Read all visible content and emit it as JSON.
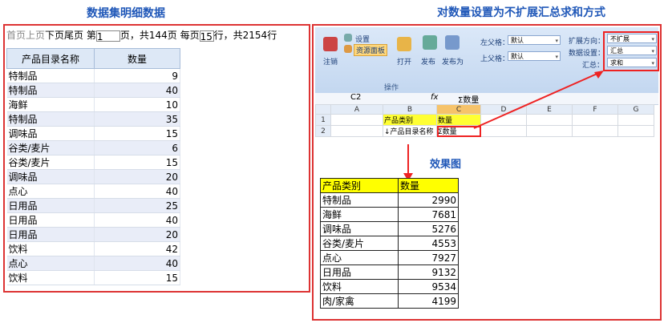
{
  "left_title": "数据集明细数据",
  "right_title": "对数量设置为不扩展汇总求和方式",
  "pager": {
    "first": "首页",
    "prev": "上页",
    "next": "下页",
    "last": "尾页",
    "page_prefix": "第",
    "page_value": "1",
    "page_suffix": "页，共144页",
    "per_page_prefix": "每页",
    "per_page_value": "15",
    "per_page_suffix": "行，共2154行"
  },
  "detail_table": {
    "headers": [
      "产品目录名称",
      "数量"
    ],
    "rows": [
      [
        "特制品",
        "9"
      ],
      [
        "特制品",
        "40"
      ],
      [
        "海鲜",
        "10"
      ],
      [
        "特制品",
        "35"
      ],
      [
        "调味品",
        "15"
      ],
      [
        "谷类/麦片",
        "6"
      ],
      [
        "谷类/麦片",
        "15"
      ],
      [
        "调味品",
        "20"
      ],
      [
        "点心",
        "40"
      ],
      [
        "日用品",
        "25"
      ],
      [
        "日用品",
        "40"
      ],
      [
        "日用品",
        "20"
      ],
      [
        "饮料",
        "42"
      ],
      [
        "点心",
        "40"
      ],
      [
        "饮料",
        "15"
      ]
    ]
  },
  "ribbon": {
    "settings": "设置",
    "resource_panel": "资源面板",
    "logout": "注销",
    "open": "打开",
    "publish": "发布",
    "publish_as": "发布为",
    "group_label": "操作",
    "left_parent_label": "左父格：",
    "left_parent_value": "默认",
    "top_parent_label": "上父格：",
    "top_parent_value": "默认",
    "expand_dir_label": "扩展方向：",
    "expand_dir_value": "不扩展",
    "data_setting_label": "数据设置：",
    "data_setting_value": "汇总",
    "summary_label": "汇总：",
    "summary_value": "求和"
  },
  "formula_bar": {
    "cell_ref": "C2",
    "fx": "fx",
    "formula": "Σ数量"
  },
  "sheet": {
    "columns": [
      "A",
      "B",
      "C",
      "D",
      "E",
      "F",
      "G"
    ],
    "rows": [
      {
        "num": "1",
        "b": "产品类别",
        "c": "数量"
      },
      {
        "num": "2",
        "b": "↓产品目录名称",
        "c": "Σ数量"
      }
    ]
  },
  "result_caption": "效果图",
  "result_table": {
    "headers": [
      "产品类别",
      "数量"
    ],
    "rows": [
      [
        "特制品",
        "2990"
      ],
      [
        "海鲜",
        "7681"
      ],
      [
        "调味品",
        "5276"
      ],
      [
        "谷类/麦片",
        "4553"
      ],
      [
        "点心",
        "7927"
      ],
      [
        "日用品",
        "9132"
      ],
      [
        "饮料",
        "9534"
      ],
      [
        "肉/家禽",
        "4199"
      ]
    ]
  },
  "colors": {
    "accent": "#1f57b8",
    "frame": "#dd3333",
    "highlight": "#ffff00"
  }
}
